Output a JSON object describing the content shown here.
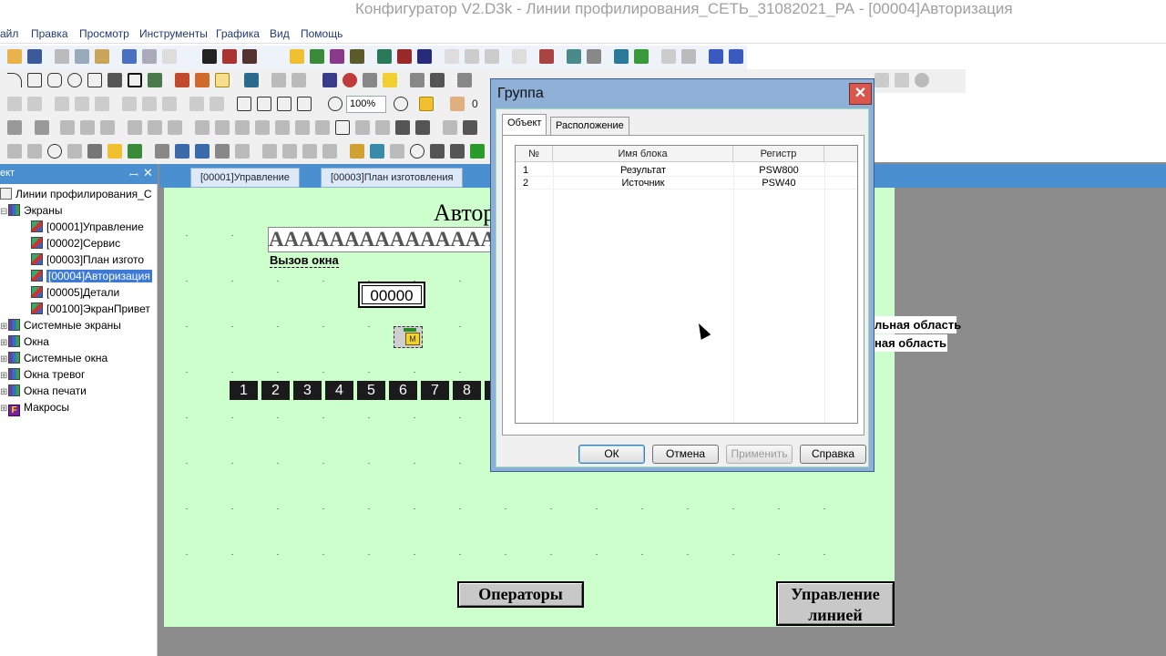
{
  "window": {
    "title": "Конфигуратор V2.D3k - Линии профилирования_СЕТЬ_31082021_РА - [00004]Авторизация"
  },
  "menu": [
    "айл",
    "Правка",
    "Просмотр",
    "Инструменты",
    "Графика",
    "Вид",
    "Помощь"
  ],
  "toolbar": {
    "zoom": "100%",
    "counter": "0"
  },
  "project_panel": {
    "title": "ект",
    "root": "Линии профилирования_С",
    "screens_folder": "Экраны",
    "screens": [
      "[00001]Управление",
      "[00002]Сервис",
      "[00003]План изгото",
      "[00004]Авторизация",
      "[00005]Детали",
      "[00100]ЭкранПривет"
    ],
    "folders": [
      "Системные экраны",
      "Окна",
      "Системные окна",
      "Окна тревог",
      "Окна печати",
      "Макросы"
    ]
  },
  "doc_tabs": [
    "[00001]Управление",
    "[00003]План изготовления"
  ],
  "canvas": {
    "title": "Автор",
    "text_field": "AAAAAAAAAAAAAAA",
    "call_link": "Вызов окна",
    "number": "00000",
    "digits": [
      "1",
      "2",
      "3",
      "4",
      "5",
      "6",
      "7",
      "8"
    ],
    "side_labels": [
      "льная область",
      "ная область"
    ],
    "operators_button": "Операторы",
    "line_control_button": "Управление линией"
  },
  "dialog": {
    "title": "Группа",
    "tabs": [
      "Объект",
      "Расположение"
    ],
    "columns": [
      "№",
      "Имя блока",
      "Регистр"
    ],
    "rows": [
      {
        "num": "1",
        "name": "Результат",
        "register": "PSW800"
      },
      {
        "num": "2",
        "name": "Источник",
        "register": "PSW40"
      }
    ],
    "buttons": {
      "ok": "ОК",
      "cancel": "Отмена",
      "apply": "Применить",
      "help": "Справка"
    }
  },
  "colors": {
    "canvas_bg": "#ccffcc",
    "panel_blue": "#4a90d0",
    "selection": "#3d7ad6",
    "close_red": "#d9574d"
  }
}
